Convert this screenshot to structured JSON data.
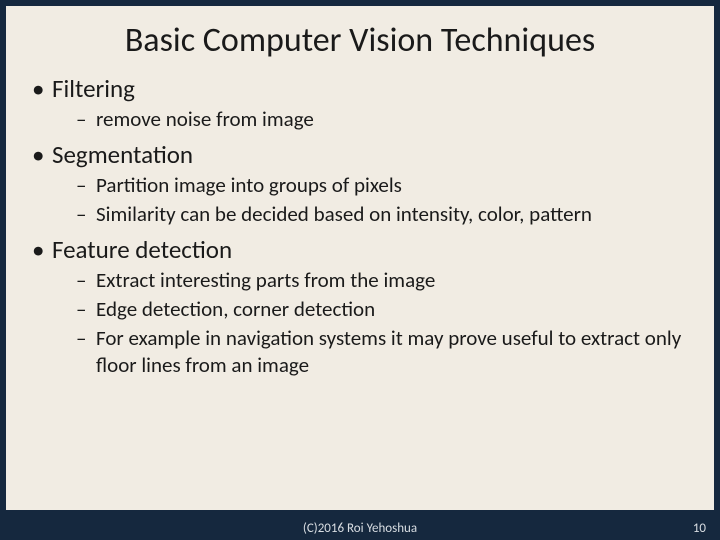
{
  "title": "Basic Computer Vision Techniques",
  "bullets": [
    {
      "label": "Filtering",
      "sub": [
        "remove noise from image"
      ]
    },
    {
      "label": "Segmentation",
      "sub": [
        "Partition image into groups of pixels",
        "Similarity can be decided based on intensity, color, pattern"
      ]
    },
    {
      "label": "Feature detection",
      "sub": [
        "Extract interesting parts from the image",
        "Edge detection, corner detection",
        "For example in navigation systems it may prove useful to extract only floor lines from an image"
      ]
    }
  ],
  "footer": {
    "center": "(C)2016 Roi Yehoshua",
    "page": "10"
  }
}
